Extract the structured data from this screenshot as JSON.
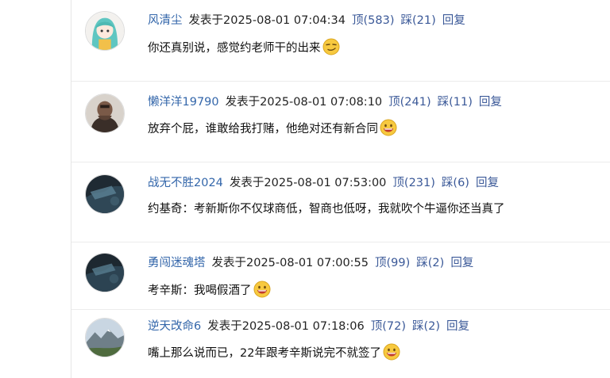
{
  "comments": [
    {
      "user": "风清尘",
      "posted_prefix": "发表于",
      "time": "2025-08-01 07:04:34",
      "up_label": "顶",
      "up_count": "(583)",
      "down_label": "踩",
      "down_count": "(21)",
      "reply_label": "回复",
      "text": "你还真别说，感觉约老师干的出来",
      "emoji": "smirk-emoji"
    },
    {
      "user": "懒洋洋19790",
      "posted_prefix": "发表于",
      "time": "2025-08-01 07:08:10",
      "up_label": "顶",
      "up_count": "(241)",
      "down_label": "踩",
      "down_count": "(11)",
      "reply_label": "回复",
      "text": "放弃个屁，谁敢给我打赌，他绝对还有新合同",
      "emoji": "grin-emoji"
    },
    {
      "user": "战无不胜2024",
      "posted_prefix": "发表于",
      "time": "2025-08-01 07:53:00",
      "up_label": "顶",
      "up_count": "(231)",
      "down_label": "踩",
      "down_count": "(6)",
      "reply_label": "回复",
      "text": "约基奇：考新斯你不仅球商低，智商也低呀，我就吹个牛逼你还当真了",
      "emoji": ""
    },
    {
      "user": "勇闯迷魂塔",
      "posted_prefix": "发表于",
      "time": "2025-08-01 07:00:55",
      "up_label": "顶",
      "up_count": "(99)",
      "down_label": "踩",
      "down_count": "(2)",
      "reply_label": "回复",
      "text": "考辛斯：我喝假酒了",
      "emoji": "grin-emoji"
    },
    {
      "user": "逆天改命6",
      "posted_prefix": "发表于",
      "time": "2025-08-01 07:18:06",
      "up_label": "顶",
      "up_count": "(72)",
      "down_label": "踩",
      "down_count": "(2)",
      "reply_label": "回复",
      "text": "嘴上那么说而已，22年跟考辛斯说完不就签了",
      "emoji": "grin-emoji"
    }
  ],
  "colors": {
    "username": "#3366aa",
    "action_link": "#3b5998",
    "separator": "#ececec"
  }
}
